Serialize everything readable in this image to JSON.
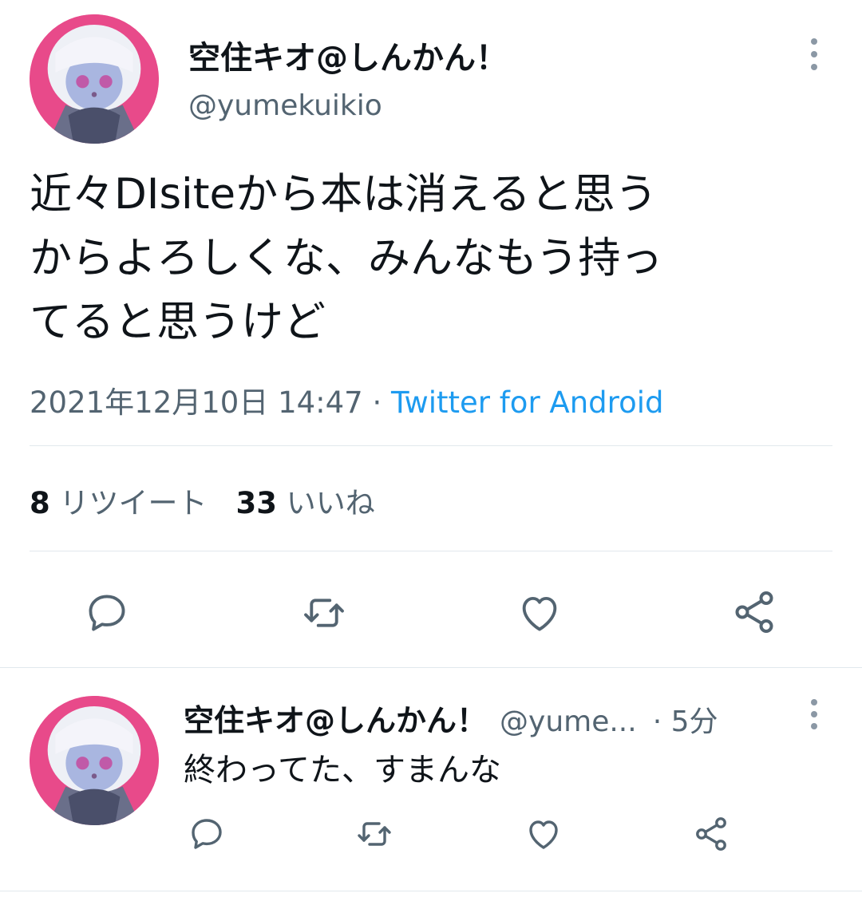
{
  "tweet": {
    "display_name": "空住キオ@しんかん！",
    "handle": "@yumekuikio",
    "text_lines": [
      "近々DIsiteから本は消えると思う",
      "からよろしくな、みんなもう持っ",
      "てると思うけど"
    ],
    "timestamp": "2021年12月10日 14:47",
    "separator": " · ",
    "source": "Twitter for Android",
    "retweet_count": "8",
    "retweet_label": "リツイート",
    "like_count": "33",
    "like_label": "いいね"
  },
  "reply": {
    "display_name": "空住キオ@しんかん！",
    "handle": "@yume...",
    "time": "· 5分",
    "text": "終わってた、すまんな"
  },
  "icons": {
    "more": "more-vertical-icon",
    "reply": "reply-icon",
    "retweet": "retweet-icon",
    "like": "heart-icon",
    "share": "share-icon"
  },
  "colors": {
    "text_primary": "#0f1419",
    "text_secondary": "#536471",
    "link": "#1d9bf0",
    "icon": "#536471",
    "divider": "#e1e8ed",
    "avatar_bg": "#e84a8a"
  }
}
